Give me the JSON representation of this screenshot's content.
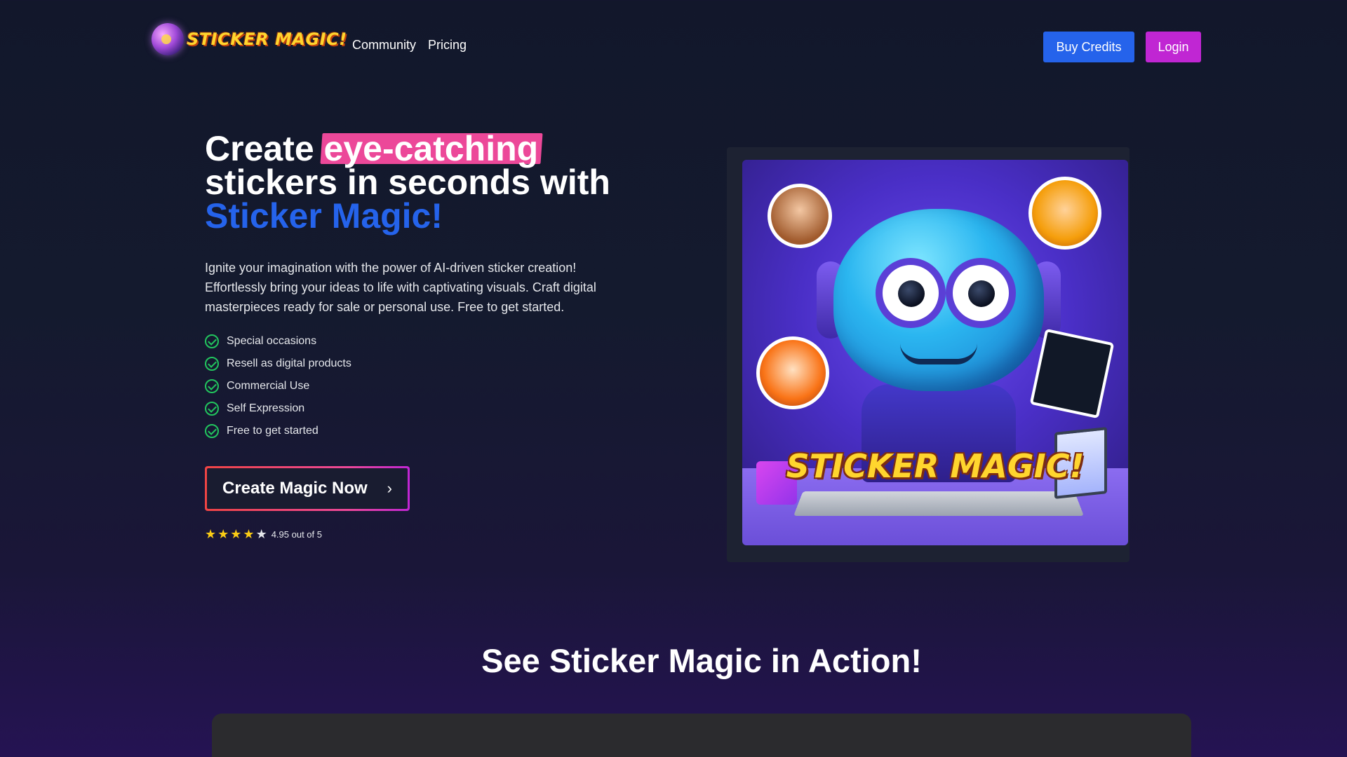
{
  "header": {
    "logo_text": "STICKER MAGIC!",
    "nav": [
      {
        "label": "Community"
      },
      {
        "label": "Pricing"
      }
    ],
    "buy_credits_label": "Buy Credits",
    "login_label": "Login"
  },
  "hero": {
    "title_part1": "Create ",
    "title_highlight": "eye-catching",
    "title_part2": "stickers in seconds with",
    "title_accent": "Sticker Magic!",
    "description": "Ignite your imagination with the power of AI-driven sticker creation! Effortlessly bring your ideas to life with captivating visuals. Craft digital masterpieces ready for sale or personal use. Free to get started.",
    "features": [
      "Special occasions",
      "Resell as digital products",
      "Commercial Use",
      "Self Expression",
      "Free to get started"
    ],
    "cta_label": "Create Magic Now",
    "cta_chevron": "›",
    "rating_stars": 5,
    "rating_text": "4.95 out of 5",
    "image_title": "STICKER MAGIC!"
  },
  "section2": {
    "title": "See Sticker Magic in Action!"
  },
  "colors": {
    "accent_blue": "#2563eb",
    "accent_purple": "#c026d3",
    "highlight_pink": "#ec4899",
    "check_green": "#22c55e",
    "star_yellow": "#facc15"
  },
  "icons": {
    "feature_check": "check-circle-icon",
    "rating_star": "star-icon",
    "cta_arrow": "chevron-right-icon"
  }
}
